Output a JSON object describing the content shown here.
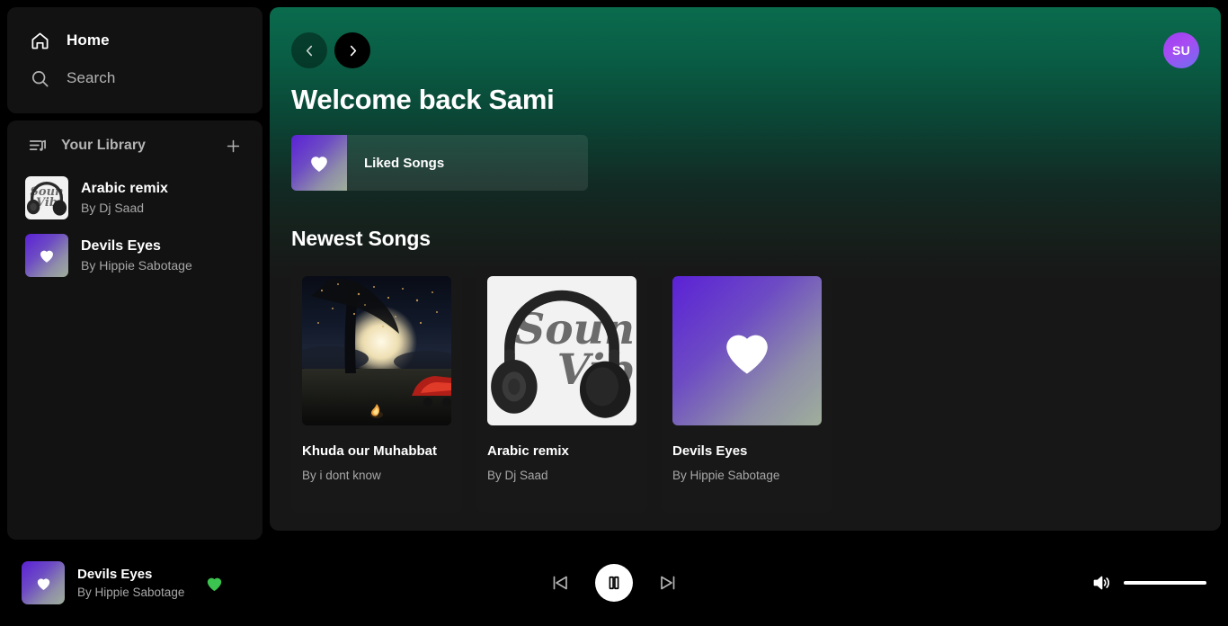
{
  "sidebar": {
    "nav": [
      {
        "label": "Home",
        "icon": "home-icon",
        "active": true
      },
      {
        "label": "Search",
        "icon": "search-icon",
        "active": false
      }
    ],
    "library": {
      "title": "Your Library",
      "library_icon": "library-icon",
      "add_icon": "plus-icon",
      "items": [
        {
          "name": "Arabic remix",
          "by": "By Dj Saad",
          "art": "headphones"
        },
        {
          "name": "Devils Eyes",
          "by": "By Hippie Sabotage",
          "art": "heart"
        }
      ]
    }
  },
  "main": {
    "nav_back_icon": "chevron-left-icon",
    "nav_forward_icon": "chevron-right-icon",
    "avatar_initials": "SU",
    "welcome": "Welcome back Sami",
    "shortcuts": [
      {
        "label": "Liked Songs",
        "art": "heart"
      }
    ],
    "section_title": "Newest Songs",
    "cards": [
      {
        "title": "Khuda our Muhabbat",
        "by": "By i dont know",
        "art": "night"
      },
      {
        "title": "Arabic remix",
        "by": "By Dj Saad",
        "art": "headphones"
      },
      {
        "title": "Devils Eyes",
        "by": "By Hippie Sabotage",
        "art": "heart"
      }
    ]
  },
  "player": {
    "now_playing": {
      "title": "Devils Eyes",
      "artist": "By Hippie Sabotage",
      "art": "heart"
    },
    "like_icon": "heart-filled-icon",
    "like_active": true,
    "prev_icon": "skip-previous-icon",
    "play_icon": "pause-icon",
    "next_icon": "skip-next-icon",
    "is_playing": true,
    "volume_icon": "volume-high-icon",
    "volume_percent": 100
  },
  "artwork": {
    "headphones_script_line1": "Soun",
    "headphones_script_line2": "Vib"
  },
  "colors": {
    "accent_green": "#3bc44f",
    "header_green": "#0a6b4d",
    "panel": "#121212",
    "card": "#181818",
    "muted_text": "#a7a7a7"
  }
}
